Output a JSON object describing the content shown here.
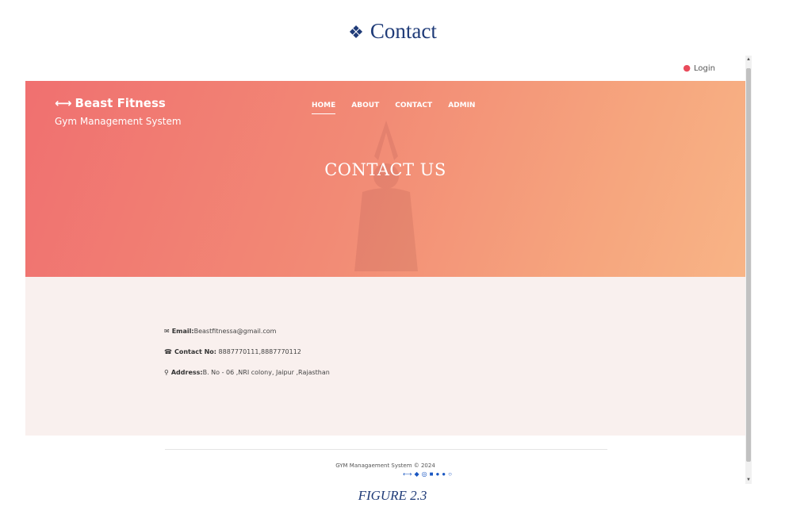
{
  "doc": {
    "heading_glyph": "❖",
    "heading": "Contact",
    "caption": "FIGURE 2.3"
  },
  "topbar": {
    "login_icon": "user-circle-icon",
    "login_label": "Login"
  },
  "header": {
    "brand": "Beast Fitness",
    "brand_icon": "dumbbell-icon",
    "tagline": "Gym Management System",
    "nav": [
      {
        "label": "HOME",
        "active": true
      },
      {
        "label": "ABOUT",
        "active": false
      },
      {
        "label": "CONTACT",
        "active": false
      },
      {
        "label": "ADMIN",
        "active": false
      }
    ],
    "hero_title": "CONTACT US"
  },
  "contact": {
    "email_label": "Email:",
    "email_value": "Beastfitnessa@gmail.com",
    "phone_label": "Contact No:",
    "phone_value": "8887770111,8887770112",
    "address_label": "Address:",
    "address_value": "B. No - 06 ,NRI colony, Jaipur ,Rajasthan"
  },
  "footer": {
    "copyright": "GYM Managaement System © 2024",
    "socials": [
      "dumbbell-icon",
      "twitter-icon",
      "instagram-icon",
      "youtube-icon",
      "facebook-icon",
      "telegram-icon",
      "whatsapp-icon"
    ]
  },
  "colors": {
    "hero_gradient_start": "#f07070",
    "hero_gradient_end": "#f8b486",
    "section_bg": "#f9f0ee",
    "doc_text": "#1f3b78",
    "social_icon": "#1a57c2"
  }
}
